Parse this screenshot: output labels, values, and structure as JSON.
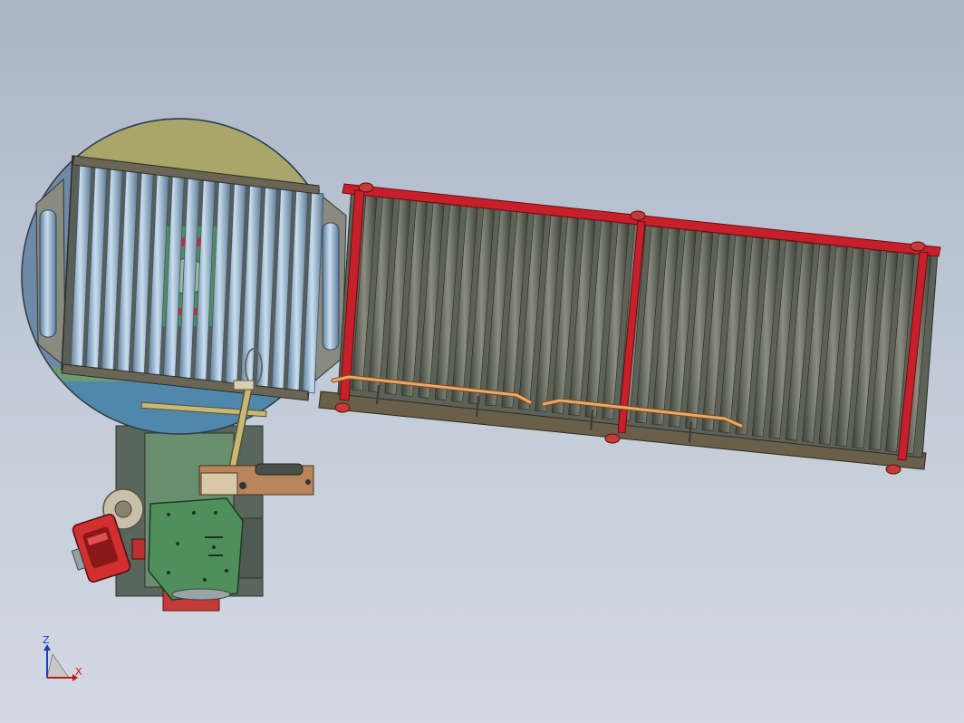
{
  "viewport": {
    "background_top": "#aab6c6",
    "background_bottom": "#d3d9e2"
  },
  "model": {
    "turntable": {
      "roller_color": "#8fb4d6",
      "rim_color": "#6f8aa8",
      "top_segment_color": "#a9a66a",
      "floor_color": "#4f88aa",
      "inner_floor_color": "#6c9c76"
    },
    "conveyor": {
      "frame_color": "#c8202a",
      "roller_color": "#6e7266",
      "rail_color": "#e8a05a",
      "base_color": "#6a5f48"
    },
    "base_unit": {
      "cabinet_color": "#5d6f63",
      "plate_color": "#3f8a4c",
      "motor_color": "#c82828",
      "arm_color": "#c8b878",
      "tape_roll_color": "#c8c0a8"
    }
  },
  "axis_triad": {
    "x_label": "X",
    "z_label": "Z",
    "x_color": "#c81414",
    "z_color": "#1e3cc8"
  }
}
